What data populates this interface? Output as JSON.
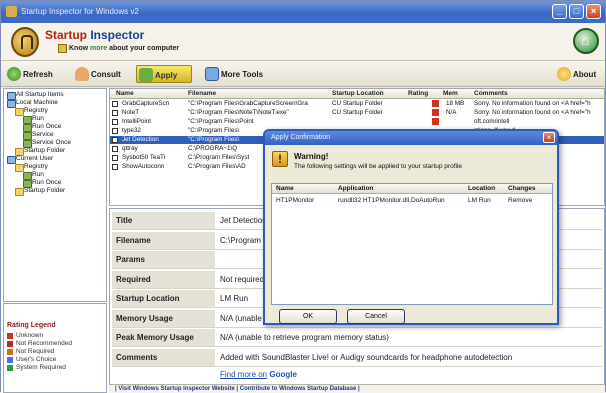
{
  "window": {
    "title": "Startup Inspector for Windows v2"
  },
  "brand": {
    "name_a": "Startup ",
    "name_b": "Inspector",
    "tagline_pre": "Know ",
    "tagline_more": "more",
    "tagline_post": " about your computer"
  },
  "toolbar": {
    "refresh": "Refresh",
    "consult": "Consult",
    "apply": "Apply",
    "more_tools": "More Tools",
    "about": "About"
  },
  "tree": [
    {
      "label": "All Startup Items",
      "type": "pc"
    },
    {
      "label": "Local Machine",
      "type": "pc"
    },
    {
      "label": "Registry",
      "type": "folder"
    },
    {
      "label": "Run",
      "type": "leaf"
    },
    {
      "label": "Run Once",
      "type": "leaf"
    },
    {
      "label": "Service",
      "type": "leaf"
    },
    {
      "label": "Service Once",
      "type": "leaf"
    },
    {
      "label": "Startup Folder",
      "type": "folder"
    },
    {
      "label": "Current User",
      "type": "pc"
    },
    {
      "label": "Registry",
      "type": "folder"
    },
    {
      "label": "Run",
      "type": "leaf"
    },
    {
      "label": "Run Once",
      "type": "leaf"
    },
    {
      "label": "Startup Folder",
      "type": "folder"
    }
  ],
  "legend": {
    "title": "Rating Legend",
    "items": [
      {
        "label": "Unknown",
        "color": "#d2321e"
      },
      {
        "label": "Not Recommended",
        "color": "#c02828"
      },
      {
        "label": "Not Required",
        "color": "#d86a1a"
      },
      {
        "label": "User's Choice",
        "color": "#3a7ad0"
      },
      {
        "label": "System Required",
        "color": "#2a9a3a"
      }
    ]
  },
  "grid": {
    "columns": [
      "Name",
      "Filename",
      "Startup Location",
      "Rating",
      "Mem",
      "Comments"
    ],
    "rows": [
      {
        "name": "GrabCaptureScn",
        "file": "\"C:\\Program Files\\GrabCaptureScreen\\Gra",
        "loc": "CU Startup Folder",
        "mem": "18 MB",
        "comment": "Sorry. No information found on <A href=\"h"
      },
      {
        "name": "NoteT",
        "file": "\"C:\\Program Files\\NoteT\\NoteT.exe\"",
        "loc": "CU Startup Folder",
        "mem": "N/A",
        "comment": "Sorry. No information found on <A href=\"h"
      },
      {
        "name": "IntelliPoint",
        "file": "\"C:\\Program Files\\Point",
        "loc": "",
        "mem": "",
        "comment": "oft.com/intell"
      },
      {
        "name": "type32",
        "file": "\"C:\\Program Files\\",
        "loc": "",
        "mem": "",
        "comment": "ptions. If you d"
      },
      {
        "name": "Jet Detection",
        "file": "\"C:\\Program Files\\",
        "loc": "",
        "mem": "",
        "comment": ""
      },
      {
        "name": "qttray",
        "file": "C:\\PROGRA~1\\Q",
        "loc": "",
        "mem": "",
        "comment": "m AntiVirus Co"
      },
      {
        "name": "Sysbot50 TeaTi",
        "file": "C:\\Program Files\\Syst",
        "loc": "",
        "mem": "",
        "comment": "lets the install"
      },
      {
        "name": "ShowAutoconn",
        "file": "C:\\Program Files\\AD",
        "loc": "",
        "mem": "",
        "comment": "a a add internet"
      }
    ]
  },
  "details": {
    "rows": [
      {
        "label": "Title",
        "value": "Jet Detection"
      },
      {
        "label": "Filename",
        "value": "C:\\Program Files\\Creative\\SBLive\\Program\\Jet Detection.exe"
      },
      {
        "label": "Params",
        "value": ""
      },
      {
        "label": "Required",
        "value": "Not required"
      },
      {
        "label": "Startup Location",
        "value": "LM Run"
      },
      {
        "label": "Memory Usage",
        "value": "N/A (unable to retrieve program memory status)"
      },
      {
        "label": "Peak Memory Usage",
        "value": "N/A (unable to retrieve program memory status)"
      },
      {
        "label": "Comments",
        "value": "Added with SoundBlaster Live! or Audigy soundcards for headphone autodetection"
      }
    ],
    "find_more": "Find more on",
    "google": "Google"
  },
  "footer": {
    "text": "| Visit Windows Startup Inspector Website | Contribute to Windows Startup Database |"
  },
  "dialog": {
    "title": "Apply Confirmation",
    "warning_title": "Warning!",
    "warning_msg": "The following settings will be applied to your startup profile",
    "columns": [
      "Name",
      "Application",
      "Location",
      "Changes"
    ],
    "rows": [
      {
        "name": "HT1PMonitor",
        "app": "rundll32 HT1PMonitor.dll,DoAutoRun",
        "loc": "LM Run",
        "change": "Remove"
      }
    ],
    "ok": "OK",
    "cancel": "Cancel"
  }
}
